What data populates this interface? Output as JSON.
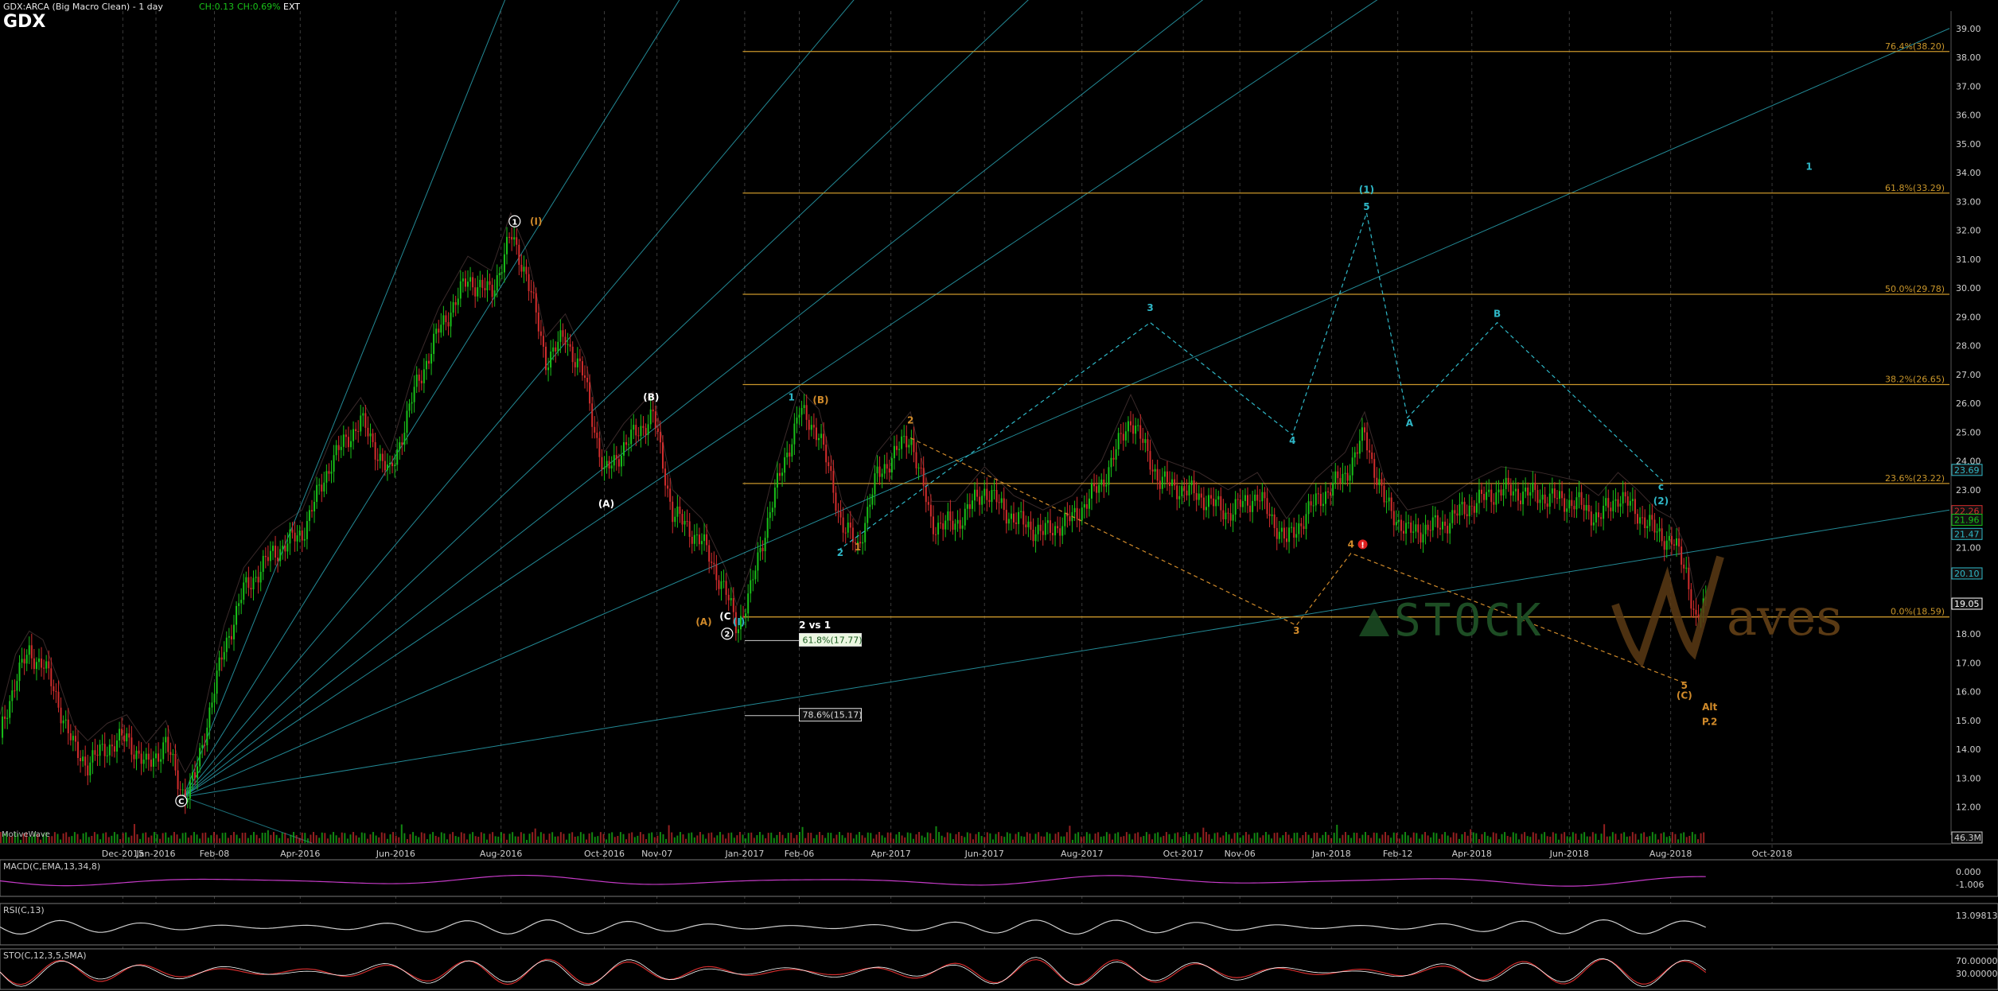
{
  "header": {
    "symbol_line": "GDX:ARCA (Big Macro Clean) - 1 day",
    "change": "CH:0.13",
    "change_pct": "CH:0.69%",
    "session": "EXT",
    "ticker": "GDX"
  },
  "watermark": {
    "brand_left": "STOCK",
    "brand_right": "aves",
    "brand_w": "W",
    "credit": "MotiveWave"
  },
  "colors": {
    "background": "#000000",
    "up_candle": "#19c119",
    "down_candle": "#d22d2d",
    "fib_gold": "#c9962a",
    "wave_cyan": "#2fb8c8",
    "wave_orange": "#d08a2a",
    "macd_line": "#c63bc8",
    "histogram": "#2fb8c8",
    "grid": "#3b3b3b",
    "axis_text": "#cfcfcf"
  },
  "chart_data": {
    "type": "candlestick",
    "title": "GDX",
    "price_axis": {
      "ticks": [
        "39.00",
        "38.00",
        "37.00",
        "36.00",
        "35.00",
        "34.00",
        "33.00",
        "32.00",
        "31.00",
        "30.00",
        "29.00",
        "28.00",
        "27.00",
        "26.00",
        "25.00",
        "24.00",
        "23.00",
        "22.00",
        "21.00",
        "20.00",
        "19.00",
        "18.00",
        "17.00",
        "16.00",
        "15.00",
        "14.00",
        "13.00",
        "12.00"
      ],
      "ylim": [
        11.3,
        39.6
      ],
      "price_labels": [
        {
          "text": "23.69",
          "value": 23.69,
          "color": "#2fb8c8"
        },
        {
          "text": "22.26",
          "value": 22.26,
          "color": "#d22d2d"
        },
        {
          "text": "21.96",
          "value": 21.96,
          "color": "#19c119"
        },
        {
          "text": "21.47",
          "value": 21.47,
          "color": "#2fb8c8"
        },
        {
          "text": "20.10",
          "value": 20.1,
          "color": "#2fb8c8"
        },
        {
          "text": "19.05",
          "value": 19.05,
          "color": "#ffffff"
        }
      ]
    },
    "time_axis": {
      "labels": [
        "Dec-2015",
        "Jan-2016",
        "Feb-08",
        "Apr-2016",
        "Jun-2016",
        "Aug-2016",
        "Oct-2016",
        "Nov-07",
        "Jan-2017",
        "Feb-06",
        "Apr-2017",
        "Jun-2017",
        "Aug-2017",
        "Oct-2017",
        "Nov-06",
        "Jan-2018",
        "Feb-12",
        "Apr-2018",
        "Jun-2018",
        "Aug-2018",
        "Oct-2018"
      ],
      "t": [
        0.063,
        0.08,
        0.11,
        0.154,
        0.203,
        0.257,
        0.31,
        0.337,
        0.382,
        0.41,
        0.457,
        0.505,
        0.555,
        0.607,
        0.636,
        0.683,
        0.717,
        0.755,
        0.805,
        0.857,
        0.909
      ]
    },
    "price_path": [
      [
        0.0,
        14.4
      ],
      [
        0.008,
        16.5
      ],
      [
        0.015,
        17.3
      ],
      [
        0.022,
        17.0
      ],
      [
        0.03,
        15.6
      ],
      [
        0.038,
        14.0
      ],
      [
        0.045,
        13.5
      ],
      [
        0.055,
        14.1
      ],
      [
        0.065,
        14.4
      ],
      [
        0.075,
        13.4
      ],
      [
        0.085,
        14.2
      ],
      [
        0.092,
        12.8
      ],
      [
        0.095,
        12.4
      ],
      [
        0.1,
        13.0
      ],
      [
        0.108,
        15.5
      ],
      [
        0.115,
        17.5
      ],
      [
        0.125,
        19.5
      ],
      [
        0.14,
        20.8
      ],
      [
        0.155,
        21.5
      ],
      [
        0.17,
        24.0
      ],
      [
        0.185,
        25.4
      ],
      [
        0.2,
        23.5
      ],
      [
        0.213,
        26.5
      ],
      [
        0.225,
        28.5
      ],
      [
        0.24,
        30.3
      ],
      [
        0.252,
        29.8
      ],
      [
        0.262,
        31.8
      ],
      [
        0.27,
        30.5
      ],
      [
        0.28,
        27.5
      ],
      [
        0.29,
        28.3
      ],
      [
        0.3,
        26.8
      ],
      [
        0.31,
        23.5
      ],
      [
        0.32,
        24.5
      ],
      [
        0.335,
        25.6
      ],
      [
        0.345,
        22.2
      ],
      [
        0.36,
        21.2
      ],
      [
        0.372,
        19.5
      ],
      [
        0.378,
        18.2
      ],
      [
        0.385,
        19.5
      ],
      [
        0.395,
        22.3
      ],
      [
        0.41,
        25.7
      ],
      [
        0.42,
        25.0
      ],
      [
        0.432,
        21.8
      ],
      [
        0.44,
        21.0
      ],
      [
        0.45,
        23.5
      ],
      [
        0.467,
        24.9
      ],
      [
        0.478,
        21.8
      ],
      [
        0.49,
        21.8
      ],
      [
        0.505,
        23.0
      ],
      [
        0.52,
        22.0
      ],
      [
        0.535,
        21.5
      ],
      [
        0.55,
        22.0
      ],
      [
        0.565,
        23.2
      ],
      [
        0.58,
        25.5
      ],
      [
        0.595,
        23.3
      ],
      [
        0.615,
        22.8
      ],
      [
        0.63,
        22.2
      ],
      [
        0.645,
        22.8
      ],
      [
        0.66,
        21.2
      ],
      [
        0.675,
        22.6
      ],
      [
        0.69,
        23.5
      ],
      [
        0.7,
        24.9
      ],
      [
        0.71,
        22.6
      ],
      [
        0.722,
        21.5
      ],
      [
        0.74,
        21.8
      ],
      [
        0.755,
        22.5
      ],
      [
        0.77,
        23.0
      ],
      [
        0.79,
        22.8
      ],
      [
        0.81,
        22.5
      ],
      [
        0.82,
        22.0
      ],
      [
        0.83,
        22.8
      ],
      [
        0.84,
        22.2
      ],
      [
        0.85,
        21.5
      ],
      [
        0.858,
        21.2
      ],
      [
        0.865,
        20.2
      ],
      [
        0.87,
        18.4
      ],
      [
        0.875,
        19.05
      ]
    ],
    "fib_levels": [
      {
        "label": "76.4%(38.20)",
        "value": 38.2
      },
      {
        "label": "61.8%(33.29)",
        "value": 33.29
      },
      {
        "label": "50.0%(29.78)",
        "value": 29.78
      },
      {
        "label": "38.2%(26.65)",
        "value": 26.65
      },
      {
        "label": "23.6%(23.22)",
        "value": 23.22
      },
      {
        "label": "0.0%(18.59)",
        "value": 18.59
      }
    ],
    "support_labels": [
      {
        "label": "61.8%(17.77)",
        "value": 17.77
      },
      {
        "label": "78.6%(15.17)",
        "value": 15.17
      }
    ],
    "wave_labels": [
      {
        "text": "1",
        "t": 0.264,
        "v": 32.2,
        "color": "#ffffff",
        "circled": true
      },
      {
        "text": "(I)",
        "t": 0.275,
        "v": 32.2,
        "color": "#d08a2a"
      },
      {
        "text": "(B)",
        "t": 0.334,
        "v": 26.1,
        "color": "#ffffff"
      },
      {
        "text": "(A)",
        "t": 0.311,
        "v": 22.4,
        "color": "#ffffff"
      },
      {
        "text": "C",
        "t": 0.093,
        "v": 12.1,
        "color": "#ffffff",
        "circled": true
      },
      {
        "text": "(A)",
        "t": 0.361,
        "v": 18.3,
        "color": "#d08a2a"
      },
      {
        "text": "(C",
        "t": 0.372,
        "v": 18.5,
        "color": "#ffffff"
      },
      {
        "text": "(I)",
        "t": 0.379,
        "v": 18.3,
        "color": "#2fb8c8"
      },
      {
        "text": "2",
        "t": 0.373,
        "v": 17.9,
        "color": "#ffffff",
        "circled": true
      },
      {
        "text": "2 vs 1",
        "t": 0.418,
        "v": 18.2,
        "color": "#ffffff"
      },
      {
        "text": "1",
        "t": 0.406,
        "v": 26.1,
        "color": "#2fb8c8"
      },
      {
        "text": "(B)",
        "t": 0.421,
        "v": 26.0,
        "color": "#d08a2a"
      },
      {
        "text": "2",
        "t": 0.431,
        "v": 20.7,
        "color": "#2fb8c8"
      },
      {
        "text": "1",
        "t": 0.44,
        "v": 20.9,
        "color": "#d08a2a"
      },
      {
        "text": "2",
        "t": 0.467,
        "v": 25.3,
        "color": "#d08a2a"
      },
      {
        "text": "3",
        "t": 0.59,
        "v": 29.2,
        "color": "#2fb8c8"
      },
      {
        "text": "4",
        "t": 0.663,
        "v": 24.6,
        "color": "#2fb8c8"
      },
      {
        "text": "(1)",
        "t": 0.701,
        "v": 33.3,
        "color": "#2fb8c8"
      },
      {
        "text": "5",
        "t": 0.701,
        "v": 32.7,
        "color": "#2fb8c8"
      },
      {
        "text": "A",
        "t": 0.723,
        "v": 25.2,
        "color": "#2fb8c8"
      },
      {
        "text": "B",
        "t": 0.768,
        "v": 29.0,
        "color": "#2fb8c8"
      },
      {
        "text": "c",
        "t": 0.852,
        "v": 23.0,
        "color": "#2fb8c8"
      },
      {
        "text": "(2)",
        "t": 0.852,
        "v": 22.5,
        "color": "#2fb8c8"
      },
      {
        "text": "1",
        "t": 0.928,
        "v": 34.1,
        "color": "#2fb8c8"
      },
      {
        "text": "4",
        "t": 0.693,
        "v": 21.0,
        "color": "#d08a2a"
      },
      {
        "text": "!",
        "t": 0.699,
        "v": 21.0,
        "color": "#ffffff",
        "alert": true
      },
      {
        "text": "3",
        "t": 0.665,
        "v": 18.0,
        "color": "#d08a2a"
      },
      {
        "text": "5",
        "t": 0.864,
        "v": 16.1,
        "color": "#d08a2a"
      },
      {
        "text": "(C)",
        "t": 0.864,
        "v": 15.75,
        "color": "#d08a2a"
      },
      {
        "text": "Alt",
        "t": 0.877,
        "v": 15.35,
        "color": "#d08a2a"
      },
      {
        "text": "P.2",
        "t": 0.877,
        "v": 14.85,
        "color": "#d08a2a"
      }
    ],
    "cyan_projection": [
      [
        0.43,
        20.9
      ],
      [
        0.59,
        28.8
      ],
      [
        0.663,
        24.9
      ],
      [
        0.701,
        32.6
      ],
      [
        0.722,
        25.5
      ],
      [
        0.768,
        28.8
      ],
      [
        0.853,
        23.3
      ]
    ],
    "orange_projection": [
      [
        0.467,
        24.8
      ],
      [
        0.665,
        18.3
      ],
      [
        0.693,
        20.8
      ],
      [
        0.864,
        16.3
      ]
    ],
    "volume": {
      "label": "46.3M"
    },
    "indicators": [
      {
        "name": "MACD(C,EMA,13,34,8)",
        "ticks": [
          "0.000",
          "-1.006"
        ]
      },
      {
        "name": "RSI(C,13)",
        "ticks": [
          "13.09813"
        ]
      },
      {
        "name": "STO(C,12,3,5,SMA)",
        "ticks": [
          "70.00000",
          "30.00000"
        ]
      }
    ]
  }
}
